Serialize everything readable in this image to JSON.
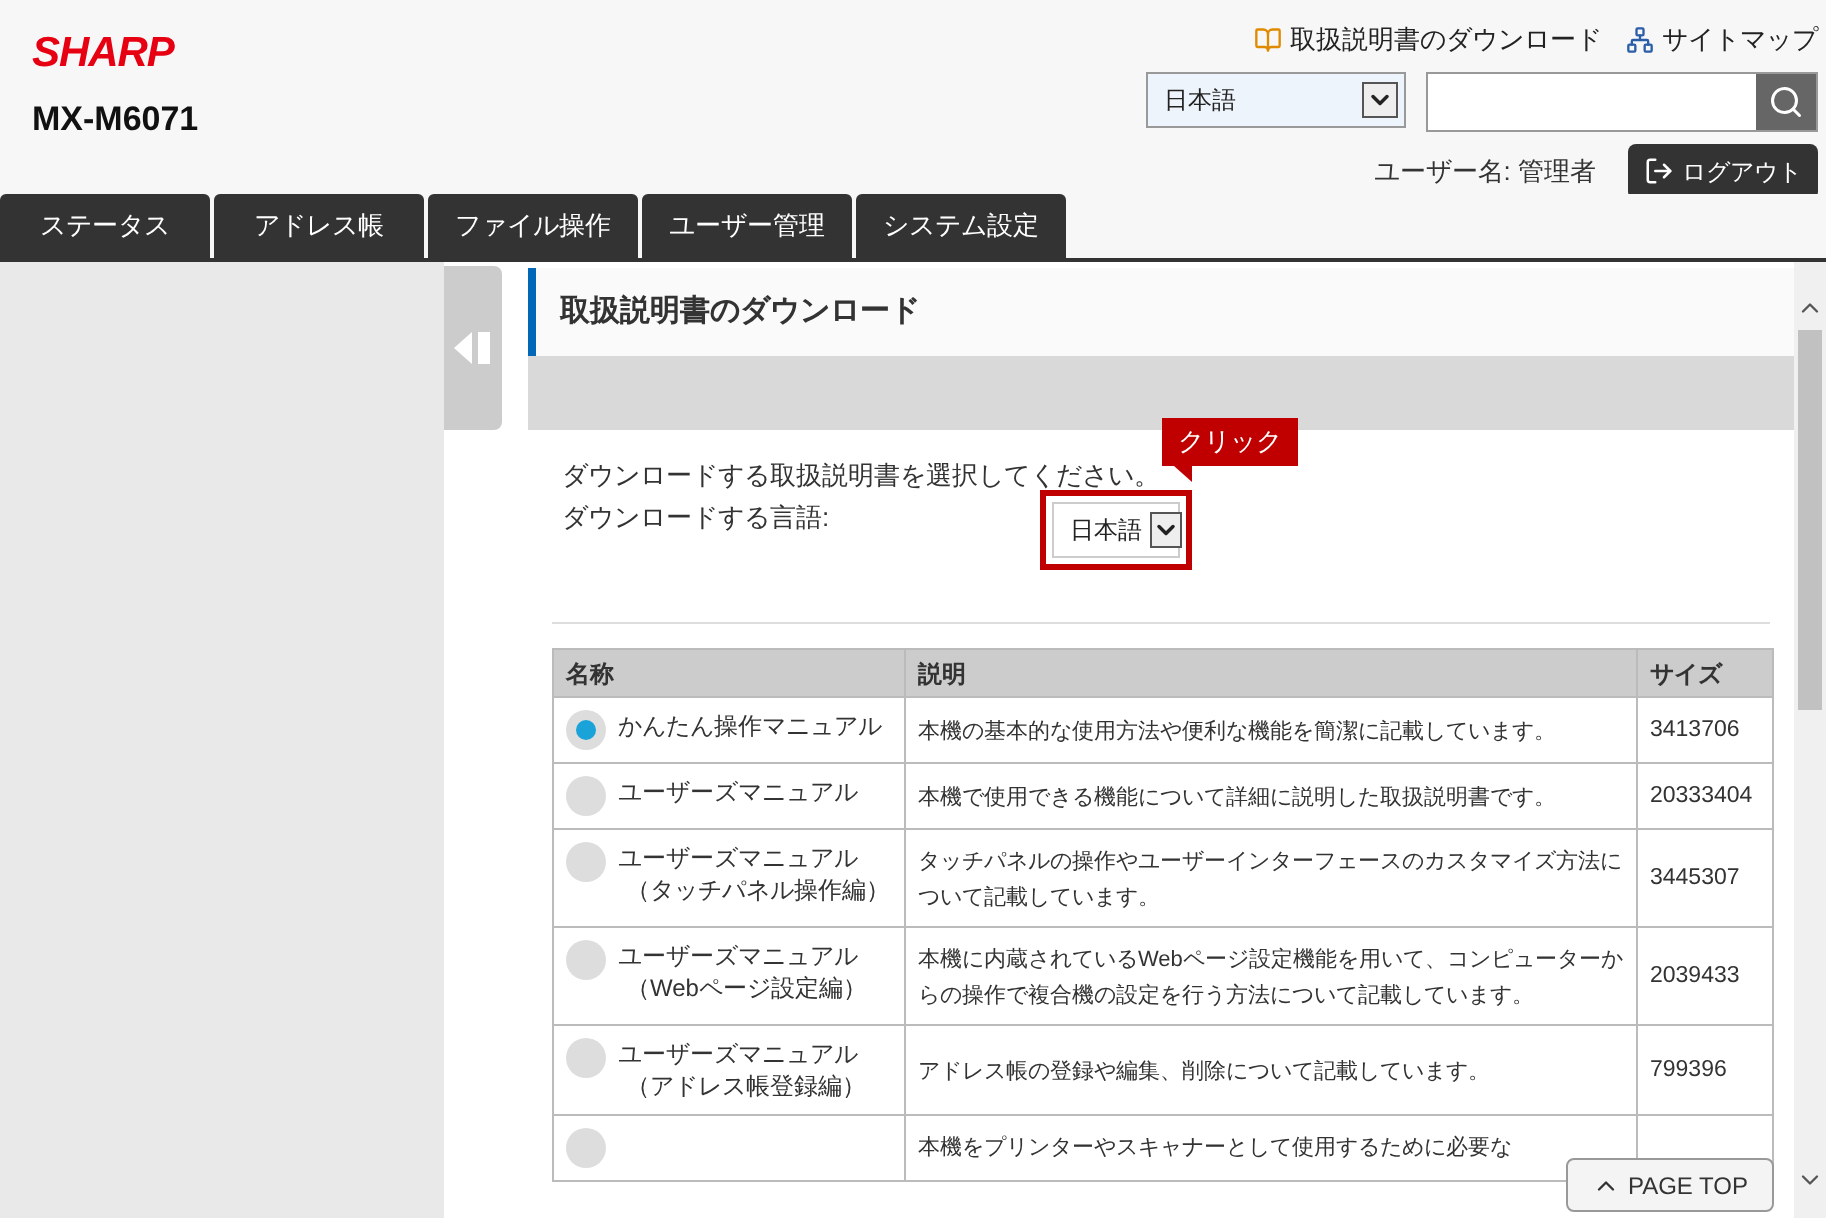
{
  "header": {
    "logo": "SHARP",
    "model": "MX-M6071",
    "links": [
      {
        "label": "取扱説明書のダウンロード",
        "kind": "manual"
      },
      {
        "label": "サイトマップ",
        "kind": "sitemap"
      }
    ],
    "language_select": {
      "value": "日本語"
    },
    "user_label": "ユーザー名: 管理者",
    "logout": "ログアウト"
  },
  "tabs": [
    {
      "label": "ステータス"
    },
    {
      "label": "アドレス帳"
    },
    {
      "label": "ファイル操作"
    },
    {
      "label": "ユーザー管理"
    },
    {
      "label": "システム設定"
    }
  ],
  "page": {
    "title": "取扱説明書のダウンロード",
    "instruction": "ダウンロードする取扱説明書を選択してください。",
    "language_label": "ダウンロードする言語:",
    "language_select": {
      "value": "日本語"
    },
    "callout": "クリック"
  },
  "table": {
    "columns": [
      "名称",
      "説明",
      "サイズ"
    ],
    "rows": [
      {
        "name": [
          "かんたん操作マニュアル"
        ],
        "description": "本機の基本的な使用方法や便利な機能を簡潔に記載しています。",
        "size": "3413706",
        "selected": true
      },
      {
        "name": [
          "ユーザーズマニュアル"
        ],
        "description": "本機で使用できる機能について詳細に説明した取扱説明書です。",
        "size": "20333404",
        "selected": false
      },
      {
        "name": [
          "ユーザーズマニュアル",
          "（タッチパネル操作編）"
        ],
        "description": "タッチパネルの操作やユーザーインターフェースのカスタマイズ方法について記載しています。",
        "size": "3445307",
        "selected": false
      },
      {
        "name": [
          "ユーザーズマニュアル",
          "（Webページ設定編）"
        ],
        "description": "本機に内蔵されているWebページ設定機能を用いて、コンピューターからの操作で複合機の設定を行う方法について記載しています。",
        "size": "2039433",
        "selected": false
      },
      {
        "name": [
          "ユーザーズマニュアル",
          "（アドレス帳登録編）"
        ],
        "description": "アドレス帳の登録や編集、削除について記載しています。",
        "size": "799396",
        "selected": false
      },
      {
        "description": "本機をプリンターやスキャナーとして使用するために必要な",
        "selected": false
      }
    ]
  },
  "page_top": "PAGE TOP"
}
